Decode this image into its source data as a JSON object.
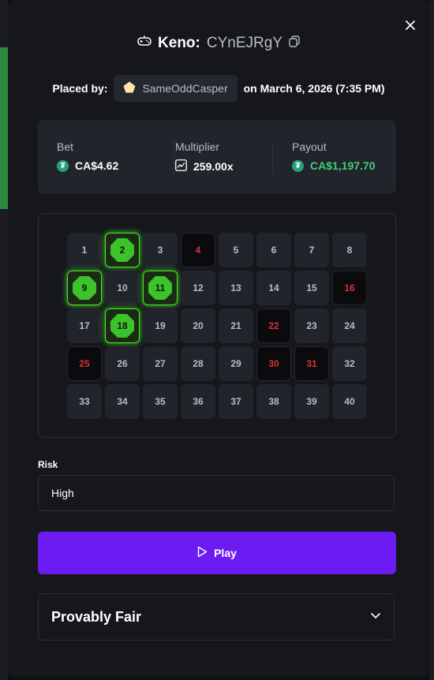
{
  "header": {
    "game": "Keno:",
    "bet_id": "CYnEJRgY",
    "game_icon": "gamepad-icon",
    "copy_icon": "copy-icon",
    "close_icon": "close-icon"
  },
  "placed": {
    "prefix": "Placed by:",
    "username": "SameOddCasper",
    "date": "on March 6, 2026 (7:35 PM)"
  },
  "stats": {
    "bet_label": "Bet",
    "bet_value": "CA$4.62",
    "multiplier_label": "Multiplier",
    "multiplier_value": "259.00x",
    "payout_label": "Payout",
    "payout_value": "CA$1,197.70"
  },
  "board": {
    "tiles": [
      {
        "n": "1",
        "state": "normal"
      },
      {
        "n": "2",
        "state": "hit"
      },
      {
        "n": "3",
        "state": "normal"
      },
      {
        "n": "4",
        "state": "miss"
      },
      {
        "n": "5",
        "state": "normal"
      },
      {
        "n": "6",
        "state": "normal"
      },
      {
        "n": "7",
        "state": "normal"
      },
      {
        "n": "8",
        "state": "normal"
      },
      {
        "n": "9",
        "state": "hit"
      },
      {
        "n": "10",
        "state": "normal"
      },
      {
        "n": "11",
        "state": "hit"
      },
      {
        "n": "12",
        "state": "normal"
      },
      {
        "n": "13",
        "state": "normal"
      },
      {
        "n": "14",
        "state": "normal"
      },
      {
        "n": "15",
        "state": "normal"
      },
      {
        "n": "16",
        "state": "miss"
      },
      {
        "n": "17",
        "state": "normal"
      },
      {
        "n": "18",
        "state": "hit"
      },
      {
        "n": "19",
        "state": "normal"
      },
      {
        "n": "20",
        "state": "normal"
      },
      {
        "n": "21",
        "state": "normal"
      },
      {
        "n": "22",
        "state": "miss"
      },
      {
        "n": "23",
        "state": "normal"
      },
      {
        "n": "24",
        "state": "normal"
      },
      {
        "n": "25",
        "state": "miss"
      },
      {
        "n": "26",
        "state": "normal"
      },
      {
        "n": "27",
        "state": "normal"
      },
      {
        "n": "28",
        "state": "normal"
      },
      {
        "n": "29",
        "state": "normal"
      },
      {
        "n": "30",
        "state": "miss"
      },
      {
        "n": "31",
        "state": "miss"
      },
      {
        "n": "32",
        "state": "normal"
      },
      {
        "n": "33",
        "state": "normal"
      },
      {
        "n": "34",
        "state": "normal"
      },
      {
        "n": "35",
        "state": "normal"
      },
      {
        "n": "36",
        "state": "normal"
      },
      {
        "n": "37",
        "state": "normal"
      },
      {
        "n": "38",
        "state": "normal"
      },
      {
        "n": "39",
        "state": "normal"
      },
      {
        "n": "40",
        "state": "normal"
      }
    ]
  },
  "risk": {
    "label": "Risk",
    "value": "High"
  },
  "play": {
    "label": "Play"
  },
  "fair": {
    "label": "Provably Fair"
  },
  "colors": {
    "accent": "#6c1cf2",
    "hit": "#4ee52b",
    "miss": "#d6333a",
    "payout": "#3fd07a",
    "coin": "#26a17b"
  }
}
